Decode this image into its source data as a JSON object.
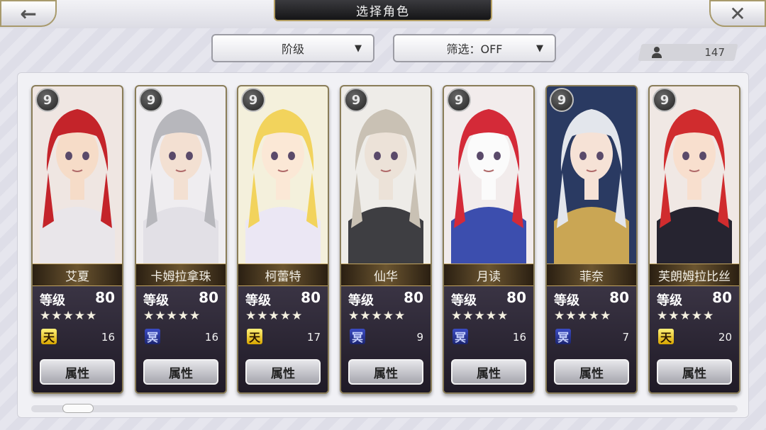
{
  "header": {
    "title": "选择角色",
    "back_icon": "←",
    "close_icon": "✕"
  },
  "filters": {
    "rank_label": "阶级",
    "filter_label": "筛选：OFF",
    "arrow": "▼"
  },
  "roster_count": "147",
  "characters": [
    {
      "name": "艾夏",
      "level_label": "等级",
      "level": "80",
      "stars": "★★★★★",
      "tier": "天",
      "tier_color": "gold",
      "rank": "16",
      "attr_label": "属性",
      "key": "9",
      "palette": {
        "bg": "#efe6e2",
        "hair": "#c4242a",
        "skin": "#f6dcc8",
        "cloth": "#e9e6ea"
      }
    },
    {
      "name": "卡姆拉拿珠",
      "level_label": "等级",
      "level": "80",
      "stars": "★★★★★",
      "tier": "冥",
      "tier_color": "blue",
      "rank": "16",
      "attr_label": "属性",
      "key": "9",
      "palette": {
        "bg": "#efedf0",
        "hair": "#b7b7bc",
        "skin": "#f3e0d2",
        "cloth": "#e2e0e6"
      }
    },
    {
      "name": "柯蕾特",
      "level_label": "等级",
      "level": "80",
      "stars": "★★★★★",
      "tier": "天",
      "tier_color": "gold",
      "rank": "17",
      "attr_label": "属性",
      "key": "9",
      "palette": {
        "bg": "#f4f0dc",
        "hair": "#f2d35c",
        "skin": "#fbe8d6",
        "cloth": "#ebe7f4"
      }
    },
    {
      "name": "仙华",
      "level_label": "等级",
      "level": "80",
      "stars": "★★★★★",
      "tier": "冥",
      "tier_color": "blue",
      "rank": "9",
      "attr_label": "属性",
      "key": "9",
      "palette": {
        "bg": "#eeece8",
        "hair": "#c9c1b4",
        "skin": "#ece2d8",
        "cloth": "#3e3e42"
      }
    },
    {
      "name": "月读",
      "level_label": "等级",
      "level": "80",
      "stars": "★★★★★",
      "tier": "冥",
      "tier_color": "blue",
      "rank": "16",
      "attr_label": "属性",
      "key": "9",
      "palette": {
        "bg": "#f2ecec",
        "hair": "#d42a38",
        "skin": "#fbfbfb",
        "cloth": "#3c4eae"
      }
    },
    {
      "name": "菲奈",
      "level_label": "等级",
      "level": "80",
      "stars": "★★★★★",
      "tier": "冥",
      "tier_color": "blue",
      "rank": "7",
      "attr_label": "属性",
      "key": "9",
      "palette": {
        "bg": "#2a3a62",
        "hair": "#e3e6ec",
        "skin": "#f6e2d6",
        "cloth": "#caa654"
      }
    },
    {
      "name": "芙朗姆拉比丝",
      "level_label": "等级",
      "level": "80",
      "stars": "★★★★★",
      "tier": "天",
      "tier_color": "gold",
      "rank": "20",
      "attr_label": "属性",
      "key": "9",
      "palette": {
        "bg": "#f0e8e4",
        "hair": "#d02c2e",
        "skin": "#f8dfce",
        "cloth": "#262430"
      }
    }
  ]
}
